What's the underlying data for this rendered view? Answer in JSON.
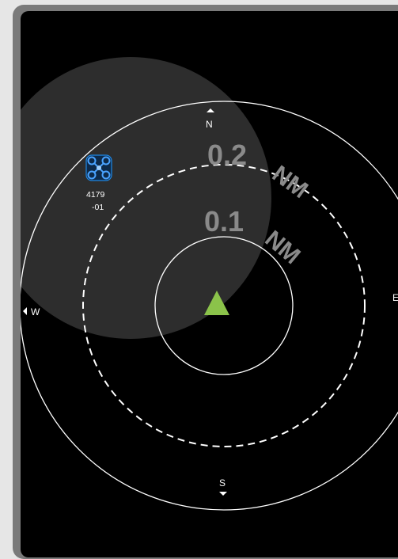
{
  "radar": {
    "cardinals": {
      "north": "N",
      "south": "S",
      "west": "W",
      "east": "E"
    },
    "ranges": {
      "outer": "0.2 NM",
      "inner": "0.1 NM"
    },
    "colors": {
      "background": "#000000",
      "rings": "#ffffff",
      "ownship": "#8bc34a",
      "track_icon": "#1e88e5",
      "range_text": "#8a8a8a"
    },
    "ownship_icon": "triangle-arrow-icon"
  },
  "track": {
    "icon": "drone-icon",
    "id_line1": "4179",
    "id_line2": "-01"
  }
}
